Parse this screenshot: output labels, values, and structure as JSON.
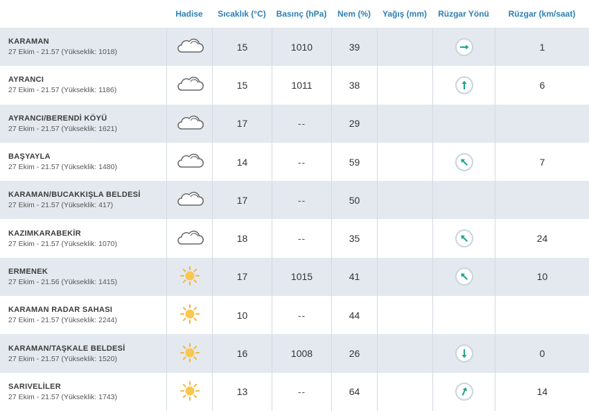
{
  "header": {
    "hadise": "Hadise",
    "sicaklik": "Sıcaklık (°C)",
    "basinc": "Basınç (hPa)",
    "nem": "Nem (%)",
    "yagis": "Yağış (mm)",
    "ruzgar_yonu": "Rüzgar Yönü",
    "ruzgar_hiz": "Rüzgar (km/saat)"
  },
  "colors": {
    "header_text": "#2d7fb3",
    "row_alt": "#e3e9ef",
    "arrow": "#1aa38a",
    "sun": "#f6c343"
  },
  "rows": [
    {
      "name": "KARAMAN",
      "sub": "27 Ekim - 21.57 (Yükseklik: 1018)",
      "icon": "cloud-icon",
      "temp": "15",
      "pressure": "1010",
      "humidity": "39",
      "rain": "",
      "wind_dir": "arrow-right-icon",
      "wind_speed": "1"
    },
    {
      "name": "AYRANCI",
      "sub": "27 Ekim - 21.57 (Yükseklik: 1186)",
      "icon": "cloud-icon",
      "temp": "15",
      "pressure": "1011",
      "humidity": "38",
      "rain": "",
      "wind_dir": "arrow-up-icon",
      "wind_speed": "6"
    },
    {
      "name": "AYRANCI/BERENDİ KÖYÜ",
      "sub": "27 Ekim - 21.57 (Yükseklik: 1621)",
      "icon": "cloud-icon",
      "temp": "17",
      "pressure": "--",
      "humidity": "29",
      "rain": "",
      "wind_dir": "",
      "wind_speed": ""
    },
    {
      "name": "BAŞYAYLA",
      "sub": "27 Ekim - 21.57 (Yükseklik: 1480)",
      "icon": "cloud-icon",
      "temp": "14",
      "pressure": "--",
      "humidity": "59",
      "rain": "",
      "wind_dir": "arrow-up-left-icon",
      "wind_speed": "7"
    },
    {
      "name": "KARAMAN/BUCAKKIŞLA BELDESİ",
      "sub": "27 Ekim - 21.57 (Yükseklik: 417)",
      "icon": "cloud-icon",
      "temp": "17",
      "pressure": "--",
      "humidity": "50",
      "rain": "",
      "wind_dir": "",
      "wind_speed": ""
    },
    {
      "name": "KAZIMKARABEKİR",
      "sub": "27 Ekim - 21.57 (Yükseklik: 1070)",
      "icon": "cloud-icon",
      "temp": "18",
      "pressure": "--",
      "humidity": "35",
      "rain": "",
      "wind_dir": "arrow-up-left-icon",
      "wind_speed": "24"
    },
    {
      "name": "ERMENEK",
      "sub": "27 Ekim - 21.56 (Yükseklik: 1415)",
      "icon": "sun-icon",
      "temp": "17",
      "pressure": "1015",
      "humidity": "41",
      "rain": "",
      "wind_dir": "arrow-up-left-icon",
      "wind_speed": "10"
    },
    {
      "name": "KARAMAN RADAR SAHASI",
      "sub": "27 Ekim - 21.57 (Yükseklik: 2244)",
      "icon": "sun-icon",
      "temp": "10",
      "pressure": "--",
      "humidity": "44",
      "rain": "",
      "wind_dir": "",
      "wind_speed": ""
    },
    {
      "name": "KARAMAN/TAŞKALE BELDESİ",
      "sub": "27 Ekim - 21.57 (Yükseklik: 1520)",
      "icon": "sun-icon",
      "temp": "16",
      "pressure": "1008",
      "humidity": "26",
      "rain": "",
      "wind_dir": "arrow-down-icon",
      "wind_speed": "0"
    },
    {
      "name": "SARIVELİLER",
      "sub": "27 Ekim - 21.57 (Yükseklik: 1743)",
      "icon": "sun-icon",
      "temp": "13",
      "pressure": "--",
      "humidity": "64",
      "rain": "",
      "wind_dir": "arrow-up-right-icon",
      "wind_speed": "14"
    }
  ]
}
